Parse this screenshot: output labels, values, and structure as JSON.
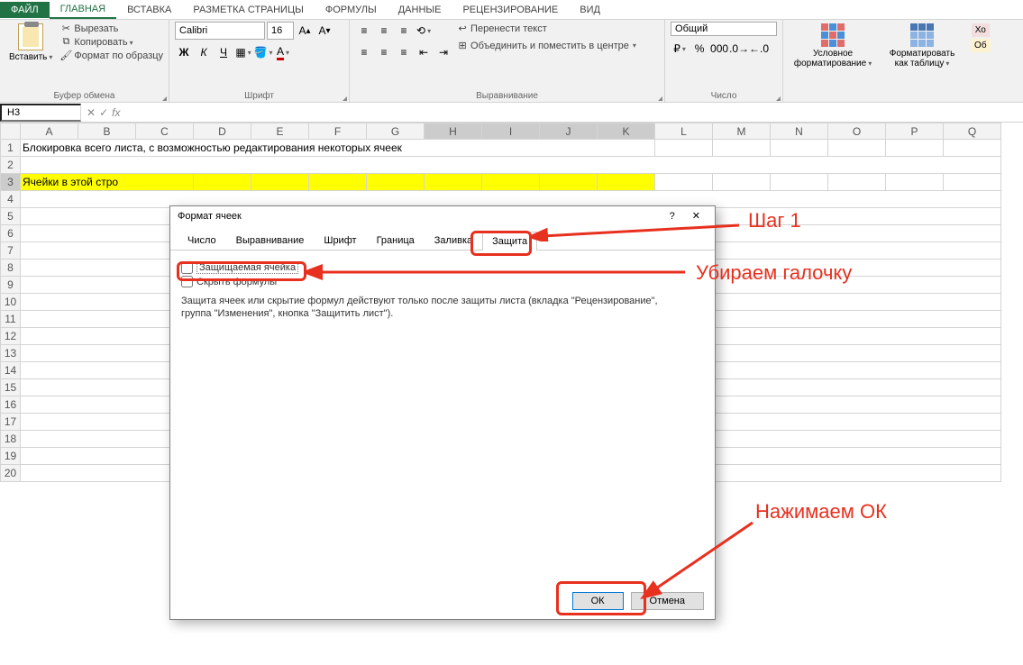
{
  "tabs": {
    "file": "ФАЙЛ",
    "home": "ГЛАВНАЯ",
    "insert": "ВСТАВКА",
    "layout": "РАЗМЕТКА СТРАНИЦЫ",
    "formulas": "ФОРМУЛЫ",
    "data": "ДАННЫЕ",
    "review": "РЕЦЕНЗИРОВАНИЕ",
    "view": "ВИД"
  },
  "ribbon": {
    "clipboard": {
      "paste": "Вставить",
      "cut": "Вырезать",
      "copy": "Копировать",
      "format_painter": "Формат по образцу",
      "label": "Буфер обмена"
    },
    "font": {
      "name": "Calibri",
      "size": "16",
      "label": "Шрифт"
    },
    "alignment": {
      "wrap": "Перенести текст",
      "merge": "Объединить и поместить в центре",
      "label": "Выравнивание"
    },
    "number": {
      "format": "Общий",
      "label": "Число"
    },
    "styles": {
      "conditional": "Условное форматирование",
      "as_table": "Форматировать как таблицу",
      "hint": "Хо"
    }
  },
  "formula_bar": {
    "name_box": "H3",
    "fx": "fx"
  },
  "columns": [
    "A",
    "B",
    "C",
    "D",
    "E",
    "F",
    "G",
    "H",
    "I",
    "J",
    "K",
    "L",
    "M",
    "N",
    "O",
    "P",
    "Q"
  ],
  "rows": [
    "1",
    "2",
    "3",
    "4",
    "5",
    "6",
    "7",
    "8",
    "9",
    "10",
    "11",
    "12",
    "13",
    "14",
    "15",
    "16",
    "17",
    "18",
    "19",
    "20"
  ],
  "cells": {
    "A1": "Блокировка всего листа, с возможностью редактирования некоторых ячеек",
    "A3": "Ячейки в этой стро"
  },
  "dialog": {
    "title": "Формат ячеек",
    "tabs": {
      "number": "Число",
      "alignment": "Выравнивание",
      "font": "Шрифт",
      "border": "Граница",
      "fill": "Заливка",
      "protection": "Защита"
    },
    "protected_cell": "Защищаемая ячейка",
    "hide_formulas": "Скрыть формулы",
    "hint": "Защита ячеек или скрытие формул действуют только после защиты листа (вкладка \"Рецензирование\", группа \"Изменения\", кнопка \"Защитить лист\").",
    "ok": "ОК",
    "cancel": "Отмена",
    "help": "?",
    "close": "✕"
  },
  "annotations": {
    "step1": "Шаг 1",
    "remove_check": "Убираем галочку",
    "press_ok": "Нажимаем ОК"
  },
  "colors": {
    "accent": "#217346",
    "anno": "#e8301f"
  }
}
